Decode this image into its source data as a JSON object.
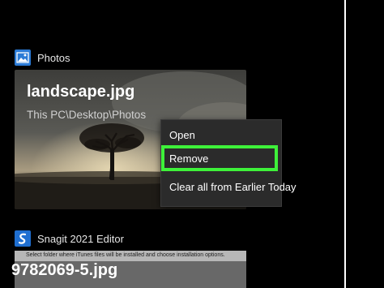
{
  "recent_items": [
    {
      "app_name": "Photos",
      "app_icon": "photos-icon",
      "file_name": "landscape.jpg",
      "path": "This PC\\Desktop\\Photos"
    },
    {
      "app_name": "Snagit 2021 Editor",
      "app_icon": "snagit-icon",
      "file_name": "9782069-5.jpg",
      "preview_text": "Select folder where iTunes files will be installed and choose installation options."
    }
  ],
  "context_menu": {
    "items": [
      "Open",
      "Remove",
      "Clear all from Earlier Today"
    ],
    "highlighted_item": "Remove",
    "highlight_color": "#3ef13a"
  },
  "colors": {
    "background": "#000000",
    "menu_background": "#2b2b2b",
    "photos_icon": "#2b7bd6"
  }
}
